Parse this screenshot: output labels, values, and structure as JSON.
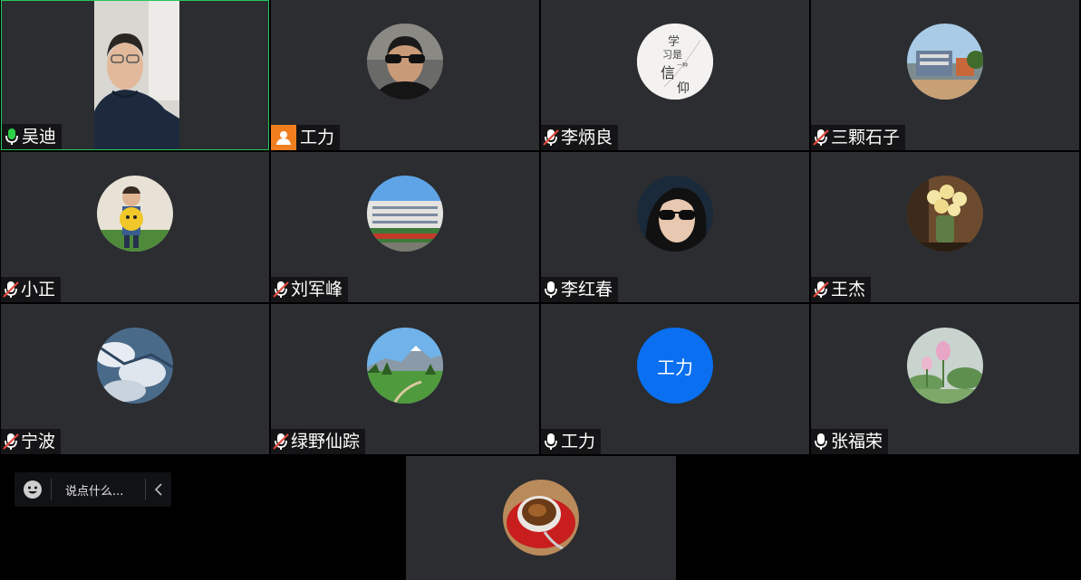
{
  "participants": [
    {
      "name": "吴迪",
      "mic": "active"
    },
    {
      "name": "工力",
      "mic": "host"
    },
    {
      "name": "李炳良",
      "mic": "muted"
    },
    {
      "name": "三颗石子",
      "mic": "muted"
    },
    {
      "name": "小正",
      "mic": "muted"
    },
    {
      "name": "刘军峰",
      "mic": "muted"
    },
    {
      "name": "李红春",
      "mic": "on"
    },
    {
      "name": "王杰",
      "mic": "muted"
    },
    {
      "name": "宁波",
      "mic": "muted"
    },
    {
      "name": "绿野仙踪",
      "mic": "muted"
    },
    {
      "name": "工力",
      "mic": "on",
      "avatar_text": "工力"
    },
    {
      "name": "张福荣",
      "mic": "on"
    }
  ],
  "avatar_calligraphy": {
    "l1": "学",
    "l2": "习是",
    "l3": "一种",
    "l4": "信",
    "l5": "仰"
  },
  "chat": {
    "placeholder": "说点什么..."
  },
  "colors": {
    "active_border": "#27c45a",
    "mic_active": "#2bd146",
    "mic_muted": "#e0463a",
    "host_badge": "#f07e1f",
    "avatar_blue": "#0a6ff0"
  }
}
